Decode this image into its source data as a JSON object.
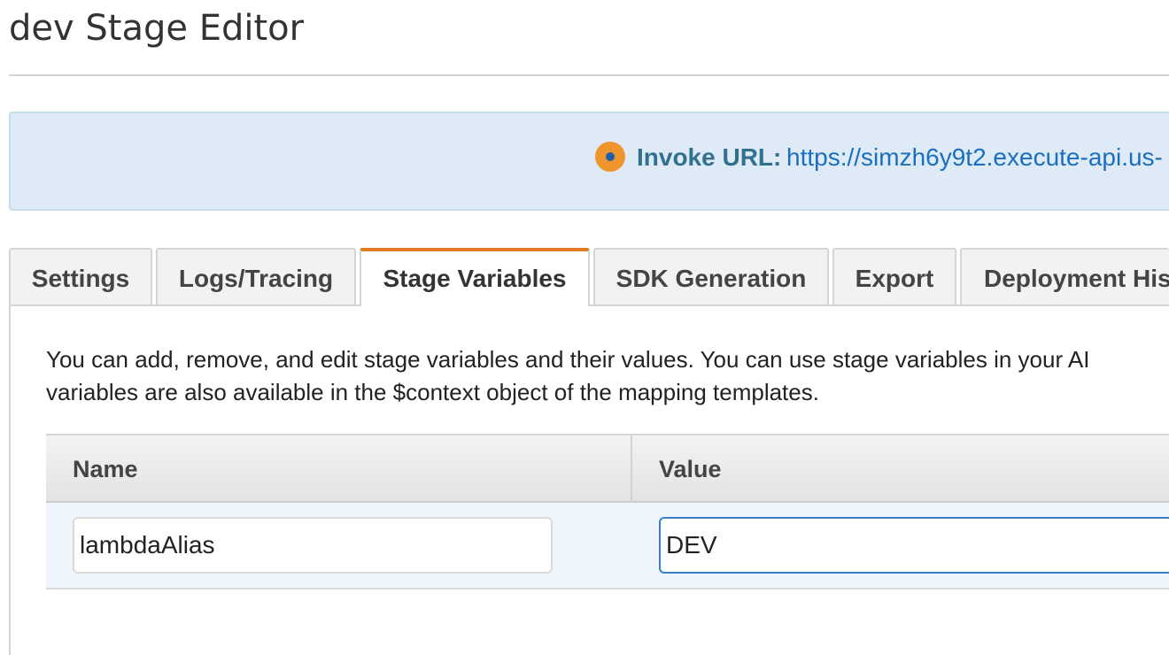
{
  "page": {
    "title": "dev Stage Editor"
  },
  "invoke": {
    "label": "Invoke URL:",
    "url": "https://simzh6y9t2.execute-api.us-",
    "icon": "info-dot-icon"
  },
  "tabs": [
    {
      "label": "Settings",
      "active": false
    },
    {
      "label": "Logs/Tracing",
      "active": false
    },
    {
      "label": "Stage Variables",
      "active": true
    },
    {
      "label": "SDK Generation",
      "active": false
    },
    {
      "label": "Export",
      "active": false
    },
    {
      "label": "Deployment His",
      "active": false
    }
  ],
  "stage_variables": {
    "description_line1": "You can add, remove, and edit stage variables and their values. You can use stage variables in your AI",
    "description_line2": "variables are also available in the $context object of the mapping templates.",
    "columns": [
      "Name",
      "Value"
    ],
    "rows": [
      {
        "name": "lambdaAlias",
        "value": "DEV"
      }
    ]
  },
  "colors": {
    "accent": "#e07b24",
    "banner_bg": "#deebf7",
    "link": "#1a6fbf",
    "focus_border": "#3b7fc4"
  }
}
